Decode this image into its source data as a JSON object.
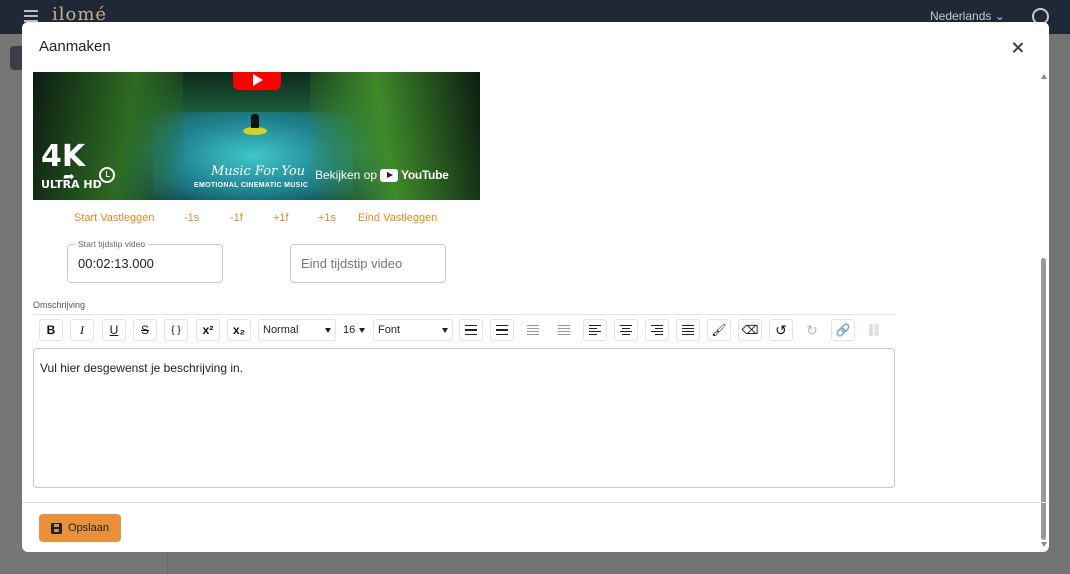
{
  "app": {
    "logo_text": "ilomé",
    "language": "Nederlands ⌄"
  },
  "modal": {
    "title": "Aanmaken"
  },
  "video": {
    "badge": "4K",
    "badge_sub": "ULTRA HD",
    "music_title": "Music For You",
    "music_subtitle": "EMOTIONAL CINEMATIC MUSIC",
    "watch_on": "Bekijken op",
    "platform": "YouTube"
  },
  "timecode_controls": {
    "start_capture": "Start Vastleggen",
    "minus_1s": "-1s",
    "minus_1f": "-1f",
    "plus_1f": "+1f",
    "plus_1s": "+1s",
    "end_capture": "Eind Vastleggen"
  },
  "start_time": {
    "label": "Start tijdstip video",
    "value": "00:02:13.000"
  },
  "end_time": {
    "placeholder": "Eind tijdstip video",
    "value": ""
  },
  "description": {
    "label": "Omschrijving",
    "placeholder": "Vul hier desgewenst je beschrijving in.",
    "toolbar": {
      "bold": "B",
      "italic": "I",
      "underline": "U",
      "strikethrough": "S",
      "code": "{ }",
      "superscript": "x²",
      "subscript": "x₂",
      "paragraph_style": "Normal",
      "font_size": "16",
      "font_family": "Font"
    }
  },
  "footer": {
    "save_label": "Opslaan"
  },
  "icons": {
    "close": "close-icon",
    "save": "floppy-disk-icon",
    "undo": "undo-icon",
    "redo": "redo-icon",
    "link": "link-icon",
    "unlink": "unlink-icon",
    "brush": "brush-icon",
    "eraser": "eraser-icon"
  },
  "colors": {
    "accent": "#e8913a",
    "link_orange": "#e38a24",
    "topbar": "#1f2836"
  }
}
